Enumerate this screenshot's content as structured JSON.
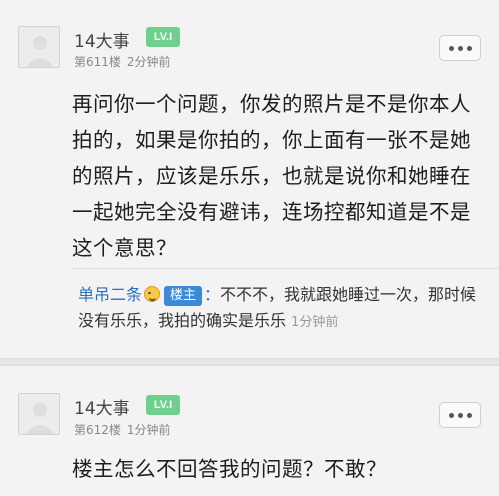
{
  "posts": [
    {
      "username": "14大事",
      "level": "LV.I",
      "floor": "第611楼",
      "time": "2分钟前",
      "content": "再问你一个问题，你发的照片是不是你本人拍的，如果是你拍的，你上面有一张不是她的照片，应该是乐乐，也就是说你和她睡在一起她完全没有避讳，连场控都知道是不是这个意思？",
      "reply": {
        "user": "单吊二条",
        "op_badge": "楼主",
        "separator": "：",
        "text": "不不不，我就跟她睡过一次，那时候没有乐乐，我拍的确实是乐乐",
        "time": "1分钟前"
      }
    },
    {
      "username": "14大事",
      "level": "LV.I",
      "floor": "第612楼",
      "time": "1分钟前",
      "content": "楼主怎么不回答我的问题？不敢？"
    }
  ],
  "icons": {
    "avatar": "default-avatar-icon",
    "more": "more-options-icon",
    "emoji": "smile-emoji-icon"
  },
  "colors": {
    "level_badge": "#6fcf8f",
    "op_badge": "#3a8ad8",
    "reply_user": "#2f6fb8"
  }
}
